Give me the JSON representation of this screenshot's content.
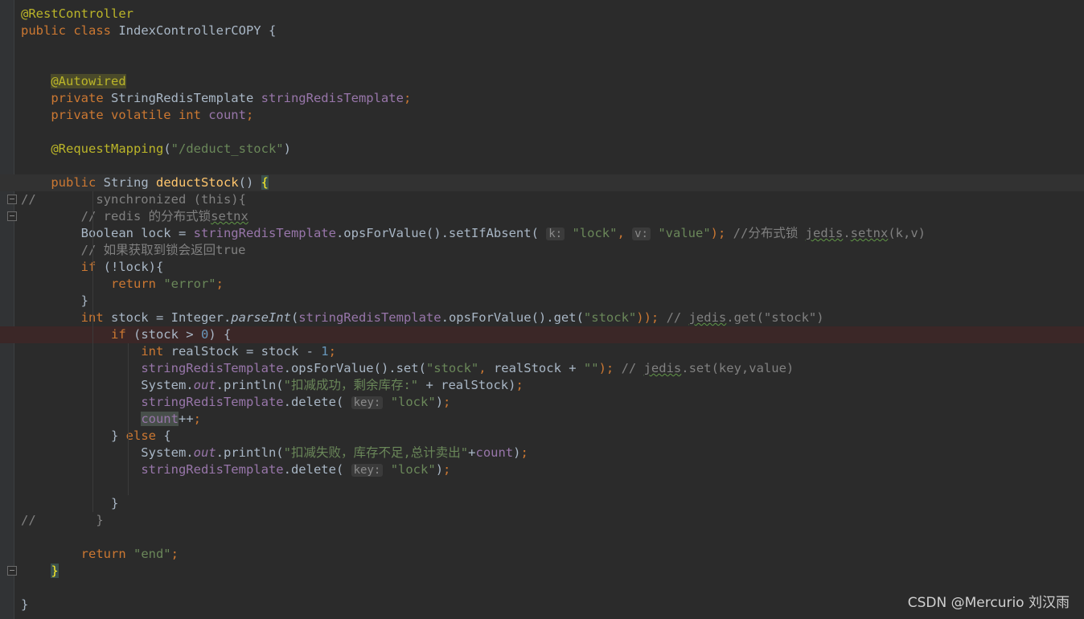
{
  "editor": {
    "language": "java",
    "lines": [
      [
        {
          "t": "@RestController",
          "c": "ann"
        }
      ],
      [
        {
          "t": "public class ",
          "c": "k"
        },
        {
          "t": "IndexControllerCOPY {"
        }
      ],
      [],
      [],
      [
        {
          "t": "    "
        },
        {
          "t": "@Autowired",
          "c": "ann-hl"
        }
      ],
      [
        {
          "t": "    "
        },
        {
          "t": "private ",
          "c": "k"
        },
        {
          "t": "StringRedisTemplate "
        },
        {
          "t": "stringRedisTemplate",
          "c": "f"
        },
        {
          "t": ";",
          "c": "k"
        }
      ],
      [
        {
          "t": "    "
        },
        {
          "t": "private volatile int ",
          "c": "k"
        },
        {
          "t": "count",
          "c": "f"
        },
        {
          "t": ";",
          "c": "k"
        }
      ],
      [],
      [
        {
          "t": "    "
        },
        {
          "t": "@RequestMapping",
          "c": "ann"
        },
        {
          "t": "("
        },
        {
          "t": "\"/deduct_stock\"",
          "c": "s"
        },
        {
          "t": ")"
        }
      ],
      [],
      [
        {
          "t": "    "
        },
        {
          "t": "public ",
          "c": "k"
        },
        {
          "t": "String "
        },
        {
          "t": "deductStock",
          "c": "m"
        },
        {
          "t": "() "
        },
        {
          "t": "{",
          "c": "brace-hl"
        }
      ],
      [
        {
          "t": "//        synchronized (this){",
          "c": "c"
        }
      ],
      [
        {
          "t": "        "
        },
        {
          "t": "// redis 的分布式锁",
          "c": "c"
        },
        {
          "t": "setnx",
          "c": "c typo"
        }
      ],
      [
        {
          "t": "        Boolean lock = "
        },
        {
          "t": "stringRedisTemplate",
          "c": "f"
        },
        {
          "t": ".opsForValue().setIfAbsent( "
        },
        {
          "t": "k:",
          "c": "hint"
        },
        {
          "t": " "
        },
        {
          "t": "\"lock\"",
          "c": "s"
        },
        {
          "t": ", ",
          "c": "k"
        },
        {
          "t": "v:",
          "c": "hint"
        },
        {
          "t": " "
        },
        {
          "t": "\"value\"",
          "c": "s"
        },
        {
          "t": "); ",
          "c": "k"
        },
        {
          "t": "//分布式锁 ",
          "c": "c"
        },
        {
          "t": "jedis",
          "c": "c typo"
        },
        {
          "t": ".",
          "c": "c"
        },
        {
          "t": "setnx",
          "c": "c typo"
        },
        {
          "t": "(k,v)",
          "c": "c"
        }
      ],
      [
        {
          "t": "        "
        },
        {
          "t": "// 如果获取到锁会返回true",
          "c": "c"
        }
      ],
      [
        {
          "t": "        "
        },
        {
          "t": "if ",
          "c": "k"
        },
        {
          "t": "(!lock){"
        }
      ],
      [
        {
          "t": "            "
        },
        {
          "t": "return ",
          "c": "k"
        },
        {
          "t": "\"error\"",
          "c": "s"
        },
        {
          "t": ";",
          "c": "k"
        }
      ],
      [
        {
          "t": "        }"
        }
      ],
      [
        {
          "t": "        "
        },
        {
          "t": "int ",
          "c": "k"
        },
        {
          "t": "stock = Integer."
        },
        {
          "t": "parseInt",
          "c": "i"
        },
        {
          "t": "("
        },
        {
          "t": "stringRedisTemplate",
          "c": "f"
        },
        {
          "t": ".opsForValue().get("
        },
        {
          "t": "\"stock\"",
          "c": "s"
        },
        {
          "t": ")); ",
          "c": "k"
        },
        {
          "t": "// ",
          "c": "c"
        },
        {
          "t": "jedis",
          "c": "c typo"
        },
        {
          "t": ".get(\"stock\")",
          "c": "c"
        }
      ],
      [
        {
          "t": "            "
        },
        {
          "t": "if ",
          "c": "k"
        },
        {
          "t": "(stock > "
        },
        {
          "t": "0",
          "c": "n"
        },
        {
          "t": ") {"
        }
      ],
      [
        {
          "t": "                "
        },
        {
          "t": "int ",
          "c": "k"
        },
        {
          "t": "realStock = stock - "
        },
        {
          "t": "1",
          "c": "n"
        },
        {
          "t": ";",
          "c": "k"
        }
      ],
      [
        {
          "t": "                "
        },
        {
          "t": "stringRedisTemplate",
          "c": "f"
        },
        {
          "t": ".opsForValue().set("
        },
        {
          "t": "\"stock\"",
          "c": "s"
        },
        {
          "t": ", ",
          "c": "k"
        },
        {
          "t": "realStock + "
        },
        {
          "t": "\"\"",
          "c": "s"
        },
        {
          "t": "); ",
          "c": "k"
        },
        {
          "t": "// ",
          "c": "c"
        },
        {
          "t": "jedis",
          "c": "c typo"
        },
        {
          "t": ".set(key,value)",
          "c": "c"
        }
      ],
      [
        {
          "t": "                System."
        },
        {
          "t": "out",
          "c": "fi"
        },
        {
          "t": ".println("
        },
        {
          "t": "\"扣减成功，剩余库存:\"",
          "c": "s"
        },
        {
          "t": " + realStock)"
        },
        {
          "t": ";",
          "c": "k"
        }
      ],
      [
        {
          "t": "                "
        },
        {
          "t": "stringRedisTemplate",
          "c": "f"
        },
        {
          "t": ".delete( "
        },
        {
          "t": "key:",
          "c": "hint"
        },
        {
          "t": " "
        },
        {
          "t": "\"lock\"",
          "c": "s"
        },
        {
          "t": ")"
        },
        {
          "t": ";",
          "c": "k"
        }
      ],
      [
        {
          "t": "                "
        },
        {
          "t": "count",
          "c": "var-hl"
        },
        {
          "t": "++"
        },
        {
          "t": ";",
          "c": "k"
        }
      ],
      [
        {
          "t": "            } "
        },
        {
          "t": "else ",
          "c": "k"
        },
        {
          "t": "{"
        }
      ],
      [
        {
          "t": "                System."
        },
        {
          "t": "out",
          "c": "fi"
        },
        {
          "t": ".println("
        },
        {
          "t": "\"扣减失败，库存不足,总计卖出\"",
          "c": "s"
        },
        {
          "t": "+"
        },
        {
          "t": "count",
          "c": "f"
        },
        {
          "t": ")"
        },
        {
          "t": ";",
          "c": "k"
        }
      ],
      [
        {
          "t": "                "
        },
        {
          "t": "stringRedisTemplate",
          "c": "f"
        },
        {
          "t": ".delete( "
        },
        {
          "t": "key:",
          "c": "hint"
        },
        {
          "t": " "
        },
        {
          "t": "\"lock\"",
          "c": "s"
        },
        {
          "t": ")"
        },
        {
          "t": ";",
          "c": "k"
        }
      ],
      [],
      [
        {
          "t": "            }"
        }
      ],
      [
        {
          "t": "//        }",
          "c": "c"
        }
      ],
      [],
      [
        {
          "t": "        "
        },
        {
          "t": "return ",
          "c": "k"
        },
        {
          "t": "\"end\"",
          "c": "s"
        },
        {
          "t": ";",
          "c": "k"
        }
      ],
      [
        {
          "t": "    "
        },
        {
          "t": "}",
          "c": "brace-hl"
        }
      ],
      [],
      [
        {
          "t": "}"
        }
      ]
    ],
    "current_line": 10,
    "error_line": 19,
    "fold_markers": [
      10,
      11,
      12,
      33
    ]
  },
  "watermark": "CSDN @Mercurio 刘汉雨",
  "colors": {
    "background": "#2b2b2b",
    "keyword": "#cc7832",
    "string": "#6a8759",
    "field": "#9876aa",
    "comment": "#808080",
    "annotation": "#bbb529",
    "method": "#ffc66d",
    "number": "#6897bb"
  }
}
